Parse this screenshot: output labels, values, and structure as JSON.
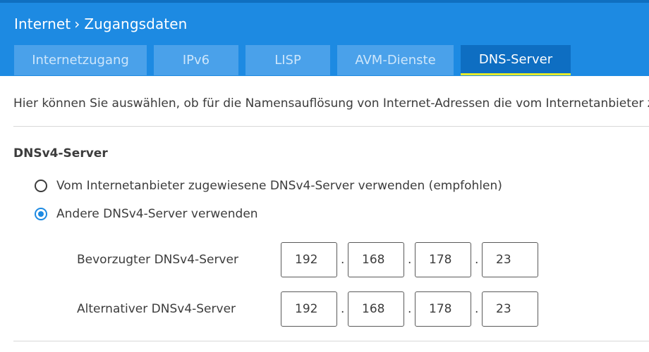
{
  "header": {
    "breadcrumb": [
      "Internet",
      "Zugangsdaten"
    ],
    "breadcrumb_separator": "›",
    "tabs": [
      {
        "label": "Internetzugang",
        "active": false
      },
      {
        "label": "IPv6",
        "active": false
      },
      {
        "label": "LISP",
        "active": false
      },
      {
        "label": "AVM-Dienste",
        "active": false
      },
      {
        "label": "DNS-Server",
        "active": true
      }
    ]
  },
  "intro": "Hier können Sie auswählen, ob für die Namensauflösung von Internet-Adressen die vom Internetanbieter zug",
  "dnsv4": {
    "title": "DNSv4-Server",
    "options": [
      {
        "label": "Vom Internetanbieter zugewiesene DNSv4-Server verwenden (empfohlen)",
        "checked": false
      },
      {
        "label": "Andere DNSv4-Server verwenden",
        "checked": true
      }
    ],
    "preferred": {
      "label": "Bevorzugter DNSv4-Server",
      "octets": [
        "192",
        "168",
        "178",
        "23"
      ]
    },
    "alternative": {
      "label": "Alternativer DNSv4-Server",
      "octets": [
        "192",
        "168",
        "178",
        "23"
      ]
    },
    "separator": "."
  },
  "colors": {
    "header_bg": "#1d8ae2",
    "tab_bg": "#4aa1ea",
    "tab_active_bg": "#0e6ec2",
    "tab_active_underline": "#e6ec2c",
    "radio_checked": "#1d8ae2"
  }
}
